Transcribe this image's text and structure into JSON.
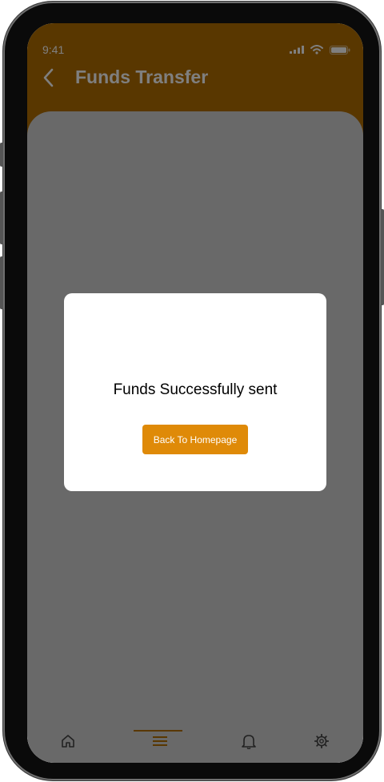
{
  "status_bar": {
    "time": "9:41"
  },
  "header": {
    "title": "Funds Transfer",
    "back_icon": "chevron-left-icon"
  },
  "dialog": {
    "message": "Funds Successfully sent",
    "button_label": "Back To Homepage"
  },
  "bottom_nav": {
    "items": [
      {
        "icon": "home-icon",
        "active": false
      },
      {
        "icon": "menu-icon",
        "active": true
      },
      {
        "icon": "bell-icon",
        "active": false
      },
      {
        "icon": "gear-icon",
        "active": false
      }
    ]
  },
  "colors": {
    "primary": "#b26e00",
    "button": "#df8a08",
    "sheet": "#d2d2d2",
    "scrim": "rgba(0,0,0,0.5)"
  }
}
